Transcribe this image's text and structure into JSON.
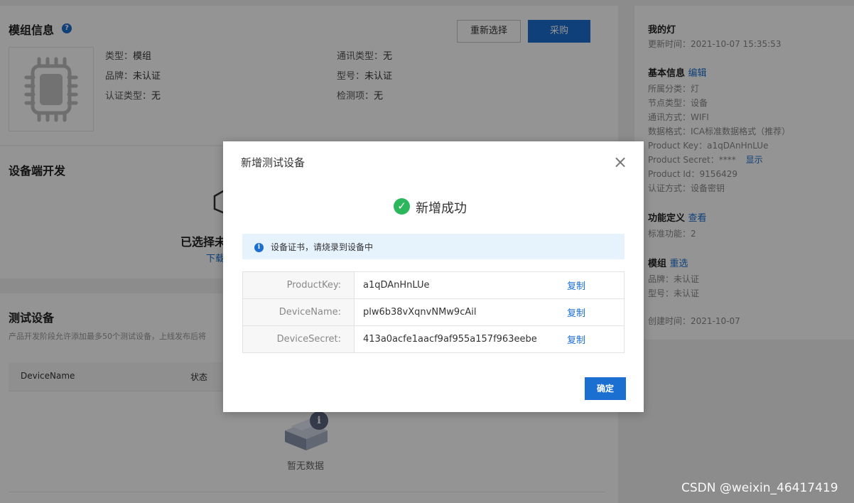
{
  "module": {
    "title": "模组信息",
    "help_icon": "?",
    "rows": [
      {
        "label": "类型：",
        "value": "模组"
      },
      {
        "label": "品牌：",
        "value": "未认证"
      },
      {
        "label": "认证类型：",
        "value": "无"
      }
    ],
    "rows_right": [
      {
        "label": "通讯类型：",
        "value": "无"
      },
      {
        "label": "型号：",
        "value": "未认证"
      },
      {
        "label": "检测项：",
        "value": "无"
      }
    ],
    "reselect_label": "重新选择",
    "purchase_label": "采购"
  },
  "device_dev": {
    "title": "设备端开发",
    "selected_text": "已选择未",
    "download_text": "下载"
  },
  "test_devices": {
    "title": "测试设备",
    "description": "产品开发阶段允许添加最多50个测试设备，上线发布后将",
    "columns": [
      "DeviceName",
      "状态"
    ],
    "empty_text": "暂无数据",
    "empty_icon": "i"
  },
  "right_panel": {
    "title": "我的灯",
    "updated": "更新时间：2021-10-07 15:35:53",
    "basic_title": "基本信息",
    "basic_edit": "编辑",
    "basic_lines": [
      "所属分类：灯",
      "节点类型：设备",
      "通讯方式：WIFI",
      "数据格式：ICA标准数据格式（推荐）",
      "Product Key：a1qDAnHnLUe"
    ],
    "secret_line": "Product Secret：****",
    "secret_show": "显示",
    "basic_lines_2": [
      "Product Id：9156429",
      "认证方式：设备密钥"
    ],
    "func_title": "功能定义",
    "func_link": "查看",
    "func_lines": [
      "标准功能：2"
    ],
    "module_title": "模组",
    "module_link": "重选",
    "module_lines": [
      "品牌：未认证",
      "型号：未认证"
    ],
    "created": "创建时间：2021-10-07"
  },
  "modal": {
    "title": "新增测试设备",
    "close_icon": "×",
    "success_icon": "✓",
    "success_text": "新增成功",
    "info_icon": "i",
    "info_text": "设备证书，请烧录到设备中",
    "rows": [
      {
        "label": "ProductKey:",
        "value": "a1qDAnHnLUe",
        "action": "复制"
      },
      {
        "label": "DeviceName:",
        "value": "plw6b38vXqnvNMw9cAil",
        "action": "复制"
      },
      {
        "label": "DeviceSecret:",
        "value": "413a0acfe1aacf9af955a157f963eebe",
        "action": "复制"
      }
    ],
    "ok_label": "确定"
  },
  "watermark": "CSDN @weixin_46417419",
  "colors": {
    "primary": "#1a6fd0",
    "success": "#2db75c",
    "info_bg": "#e6f2fc"
  }
}
